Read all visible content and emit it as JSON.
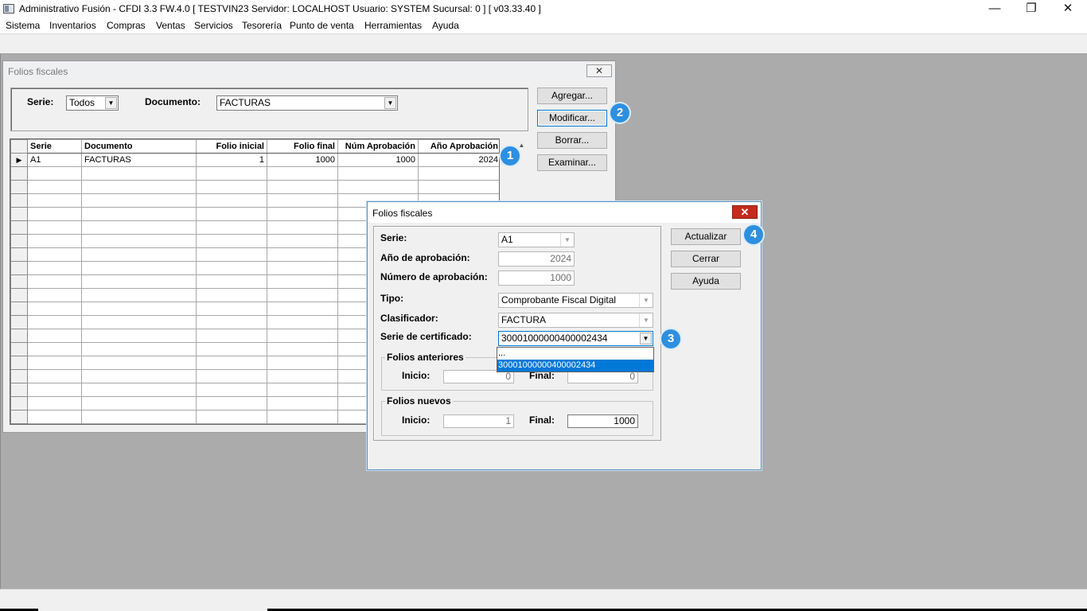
{
  "app": {
    "title": "Administrativo Fusión - CFDI 3.3 FW.4.0 [ TESTVIN23   Servidor: LOCALHOST   Usuario: SYSTEM     Sucursal: 0 ] [ v03.33.40 ]",
    "window_controls": {
      "minimize": "—",
      "restore": "❐",
      "close": "✕"
    }
  },
  "menu": [
    "Sistema",
    "Inventarios",
    "Compras",
    "Ventas",
    "Servicios",
    "Tesorería",
    "Punto de venta",
    "Herramientas",
    "Ayuda"
  ],
  "folios_window": {
    "title": "Folios fiscales",
    "close": "✕",
    "filter": {
      "serie_label": "Serie:",
      "serie_value": "Todos",
      "documento_label": "Documento:",
      "documento_value": "FACTURAS"
    },
    "buttons": {
      "agregar": "Agregar...",
      "modificar": "Modificar...",
      "borrar": "Borrar...",
      "examinar": "Examinar..."
    },
    "grid": {
      "columns": [
        "Serie",
        "Documento",
        "Folio inicial",
        "Folio final",
        "Núm Aprobación",
        "Año Aprobación"
      ],
      "rows": [
        {
          "serie": "A1",
          "documento": "FACTURAS",
          "folio_inicial": "1",
          "folio_final": "1000",
          "num_aprobacion": "1000",
          "anio_aprobacion": "2024"
        }
      ],
      "row_indicator": "▶",
      "scroll_up": "▲"
    }
  },
  "dialog": {
    "title": "Folios fiscales",
    "close": "✕",
    "labels": {
      "serie": "Serie:",
      "anio": "Año de aprobación:",
      "numero": "Número de aprobación:",
      "tipo": "Tipo:",
      "clasificador": "Clasificador:",
      "serie_cert": "Serie de certificado:"
    },
    "values": {
      "serie": "A1",
      "anio": "2024",
      "numero": "1000",
      "tipo": "Comprobante Fiscal Digital",
      "clasificador": "FACTURA",
      "serie_cert": "30001000000400002434"
    },
    "cert_options": [
      "...",
      "30001000000400002434"
    ],
    "folios_anteriores": {
      "title": "Folios anteriores",
      "inicio_label": "Inicio:",
      "inicio": "0",
      "final_label": "Final:",
      "final": "0"
    },
    "folios_nuevos": {
      "title": "Folios nuevos",
      "inicio_label": "Inicio:",
      "inicio": "1",
      "final_label": "Final:",
      "final": "1000"
    },
    "buttons": {
      "actualizar": "Actualizar",
      "cerrar": "Cerrar",
      "ayuda": "Ayuda"
    }
  },
  "callouts": [
    "1",
    "2",
    "3",
    "4"
  ],
  "icons": {
    "dropdown": "▼"
  }
}
